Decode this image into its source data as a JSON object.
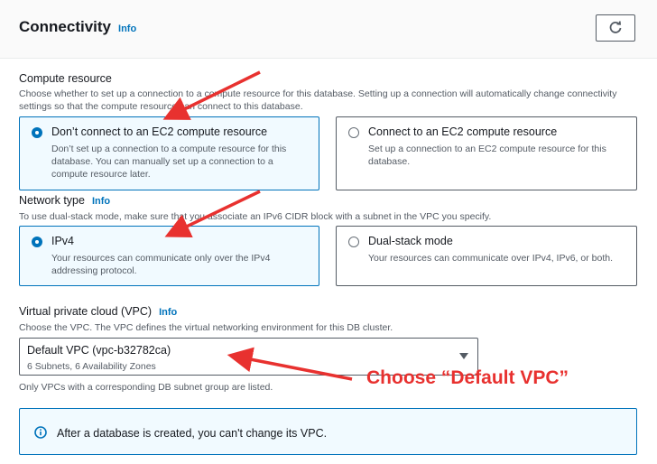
{
  "header": {
    "title": "Connectivity",
    "info": "Info"
  },
  "compute": {
    "label": "Compute resource",
    "desc": "Choose whether to set up a connection to a compute resource for this database. Setting up a connection will automatically change connectivity settings so that the compute resource can connect to this database.",
    "options": [
      {
        "title": "Don’t connect to an EC2 compute resource",
        "desc": "Don’t set up a connection to a compute resource for this database. You can manually set up a connection to a compute resource later.",
        "selected": true
      },
      {
        "title": "Connect to an EC2 compute resource",
        "desc": "Set up a connection to an EC2 compute resource for this database.",
        "selected": false
      }
    ]
  },
  "network": {
    "label": "Network type",
    "info": "Info",
    "desc": "To use dual-stack mode, make sure that you associate an IPv6 CIDR block with a subnet in the VPC you specify.",
    "options": [
      {
        "title": "IPv4",
        "desc": "Your resources can communicate only over the IPv4 addressing protocol.",
        "selected": true
      },
      {
        "title": "Dual-stack mode",
        "desc": "Your resources can communicate over IPv4, IPv6, or both.",
        "selected": false
      }
    ]
  },
  "vpc": {
    "label": "Virtual private cloud (VPC)",
    "info": "Info",
    "desc": "Choose the VPC. The VPC defines the virtual networking environment for this DB cluster.",
    "value": "Default VPC (vpc-b32782ca)",
    "sub": "6 Subnets, 6 Availability Zones",
    "note": "Only VPCs with a corresponding DB subnet group are listed."
  },
  "alert": {
    "text": "After a database is created, you can't change its VPC."
  },
  "annotation": {
    "text": "Choose “Default VPC”",
    "color": "#e8312f"
  },
  "colors": {
    "accent": "#0073bb",
    "arrow": "#e8312f"
  }
}
